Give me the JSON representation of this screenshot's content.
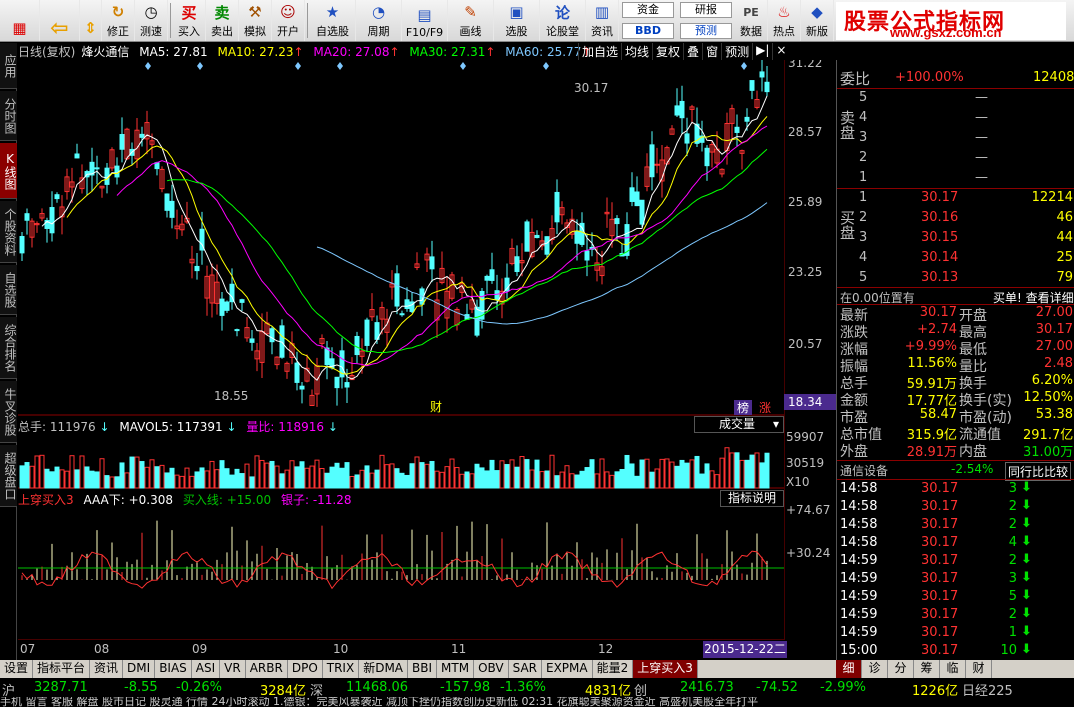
{
  "toolbar": {
    "buttons": [
      "修正",
      "测速",
      "买入",
      "卖出",
      "模拟",
      "开户",
      "自选股",
      "周期",
      "F10/F9",
      "画线",
      "选股",
      "论股堂",
      "资讯",
      "数据",
      "热点",
      "新版"
    ],
    "stack_left": [
      "资金",
      "BBD"
    ],
    "stack_right": [
      "研报",
      "预测"
    ],
    "brand_title": "股票公式指标网",
    "brand_url": "www.gsxz.com.cn"
  },
  "left_tabs": [
    "应用",
    "分时图",
    "K线图",
    "个股资料",
    "自选股",
    "综合排名",
    "牛叉诊股",
    "超级盘口"
  ],
  "chart": {
    "period": "日线(复权)",
    "stock_name": "烽火通信",
    "ma": [
      {
        "label": "MA5: 27.81",
        "color": "#ffffff"
      },
      {
        "label": "MA10: 27.23",
        "color": "#ffff00"
      },
      {
        "label": "MA20: 27.08",
        "color": "#ff00ff"
      },
      {
        "label": "MA30: 27.31",
        "color": "#00ff00"
      },
      {
        "label": "MA60: 25.77",
        "color": "#7ec8ff"
      }
    ],
    "tools": [
      "加自选",
      "均线",
      "复权",
      "叠",
      "窗",
      "预测"
    ],
    "price_axis": [
      "31.22",
      "28.57",
      "25.89",
      "23.25",
      "20.57",
      "18.34"
    ],
    "high_label": "30.17",
    "low_label": "18.55",
    "markers": [
      "财",
      "榜",
      "涨"
    ]
  },
  "volume": {
    "total": "总手: 111976",
    "mavol": "MAVOL5: 117391",
    "ratio": "量比: 118916",
    "button": "成交量",
    "axis": [
      "59907",
      "30519",
      "X10"
    ]
  },
  "indicator": {
    "name": "上穿买入3",
    "aaa": "AAA下: +0.308",
    "buy_line": "买入线: +15.00",
    "yinzi": "银子: -11.28",
    "button": "指标说明",
    "axis": [
      "+74.67",
      "+30.24"
    ]
  },
  "dates": [
    "07",
    "08",
    "09",
    "10",
    "11",
    "12"
  ],
  "date_badge": "2015-12-22二",
  "bottom_tabs": [
    "设置",
    "指标平台",
    "资讯",
    "DMI",
    "BIAS",
    "ASI",
    "VR",
    "ARBR",
    "DPO",
    "TRIX",
    "新DMA",
    "BBI",
    "MTM",
    "OBV",
    "SAR",
    "EXPMA",
    "能量2",
    "上穿买入3"
  ],
  "side_tabs": [
    "细",
    "诊",
    "分",
    "筹",
    "临",
    "财"
  ],
  "index_bar": {
    "sh_label": "沪",
    "sh_price": "3287.71",
    "sh_change": "-8.55",
    "sh_pct": "-0.26%",
    "sh_amount": "3284亿",
    "sz_label": "深",
    "sz_price": "11468.06",
    "sz_change": "-157.98",
    "sz_pct": "-1.36%",
    "sz_amount": "4831亿",
    "cy_label": "创",
    "cy_price": "2416.73",
    "cy_change": "-74.52",
    "cy_pct": "-2.99%",
    "cy_amount": "1226亿",
    "extra": "日经225"
  },
  "news": "手机  留言  客服  解盘  股市日记  股灵通  行情  24小时滚动  1.德银：完美风暴袭近 减顶下挫仍指数创历史新低   02:31  花旗聪美聚源资金近  高盛机美股全年打平",
  "quote": {
    "weibi_label": "委比",
    "weibi_value": "+100.00%",
    "weicha": "12408",
    "sell_label": "卖盘",
    "sell": [
      {
        "lvl": "5",
        "price": "—",
        "vol": ""
      },
      {
        "lvl": "4",
        "price": "—",
        "vol": ""
      },
      {
        "lvl": "3",
        "price": "—",
        "vol": ""
      },
      {
        "lvl": "2",
        "price": "—",
        "vol": ""
      },
      {
        "lvl": "1",
        "price": "—",
        "vol": ""
      }
    ],
    "buy_label": "买盘",
    "buy": [
      {
        "lvl": "1",
        "price": "30.17",
        "vol": "12214"
      },
      {
        "lvl": "2",
        "price": "30.16",
        "vol": "46"
      },
      {
        "lvl": "3",
        "price": "30.15",
        "vol": "44"
      },
      {
        "lvl": "4",
        "price": "30.14",
        "vol": "25"
      },
      {
        "lvl": "5",
        "price": "30.13",
        "vol": "79"
      }
    ],
    "position_text": "在0.00位置有",
    "buy_single": "买单! 查看详细",
    "stats": [
      [
        "最新",
        "30.17",
        "开盘",
        "27.00"
      ],
      [
        "涨跌",
        "+2.74",
        "最高",
        "30.17"
      ],
      [
        "涨幅",
        "+9.99%",
        "最低",
        "27.00"
      ],
      [
        "振幅",
        "11.56%",
        "量比",
        "2.48"
      ],
      [
        "总手",
        "59.91万",
        "换手",
        "6.20%"
      ],
      [
        "金额",
        "17.77亿",
        "换手(实)",
        "12.50%"
      ],
      [
        "市盈",
        "58.47",
        "市盈(动)",
        "53.38"
      ],
      [
        "总市值",
        "315.9亿",
        "流通值",
        "291.7亿"
      ],
      [
        "外盘",
        "28.91万",
        "内盘",
        "31.00万"
      ]
    ],
    "sector": "通信设备",
    "sector_pct": "-2.54%",
    "compare": "同行比比较",
    "ticks": [
      {
        "time": "14:58",
        "price": "30.17",
        "vol": "3"
      },
      {
        "time": "14:58",
        "price": "30.17",
        "vol": "2"
      },
      {
        "time": "14:58",
        "price": "30.17",
        "vol": "2"
      },
      {
        "time": "14:58",
        "price": "30.17",
        "vol": "4"
      },
      {
        "time": "14:59",
        "price": "30.17",
        "vol": "2"
      },
      {
        "time": "14:59",
        "price": "30.17",
        "vol": "3"
      },
      {
        "time": "14:59",
        "price": "30.17",
        "vol": "5"
      },
      {
        "time": "14:59",
        "price": "30.17",
        "vol": "2"
      },
      {
        "time": "14:59",
        "price": "30.17",
        "vol": "1"
      },
      {
        "time": "15:00",
        "price": "30.17",
        "vol": "10"
      }
    ]
  },
  "colors": {
    "up": "#ff3232",
    "down": "#54ffff",
    "grid": "#8b0000",
    "ma5": "#ffffff",
    "ma10": "#ffff00",
    "ma20": "#ff00ff",
    "ma30": "#00ff00",
    "ma60": "#7ec8ff"
  }
}
